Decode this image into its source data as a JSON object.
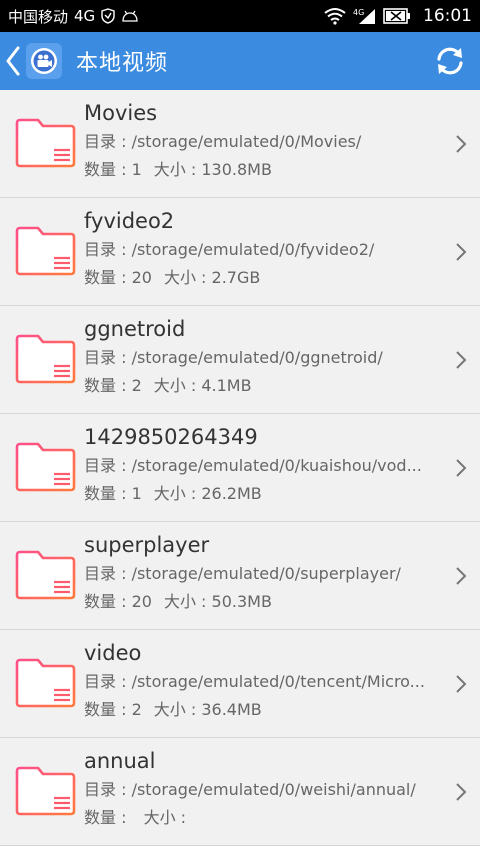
{
  "status_bar": {
    "carrier": "中国移动",
    "network": "4G",
    "time": "16:01",
    "signal_label": "4G"
  },
  "header": {
    "title": "本地视频",
    "accent": "#3b8be0"
  },
  "labels": {
    "dir": "目录 : ",
    "count": "数量 : ",
    "size": "大小 : "
  },
  "items": [
    {
      "name": "Movies",
      "path": "/storage/emulated/0/Movies/",
      "count": "1",
      "size": "130.8MB"
    },
    {
      "name": "fyvideo2",
      "path": "/storage/emulated/0/fyvideo2/",
      "count": "20",
      "size": "2.7GB"
    },
    {
      "name": "ggnetroid",
      "path": "/storage/emulated/0/ggnetroid/",
      "count": "2",
      "size": "4.1MB"
    },
    {
      "name": "1429850264349",
      "path": "/storage/emulated/0/kuaishou/vod...",
      "count": "1",
      "size": "26.2MB"
    },
    {
      "name": "superplayer",
      "path": "/storage/emulated/0/superplayer/",
      "count": "20",
      "size": "50.3MB"
    },
    {
      "name": "video",
      "path": "/storage/emulated/0/tencent/Micro...",
      "count": "2",
      "size": "36.4MB"
    },
    {
      "name": "annual",
      "path": "/storage/emulated/0/weishi/annual/",
      "count": "",
      "size": ""
    }
  ]
}
